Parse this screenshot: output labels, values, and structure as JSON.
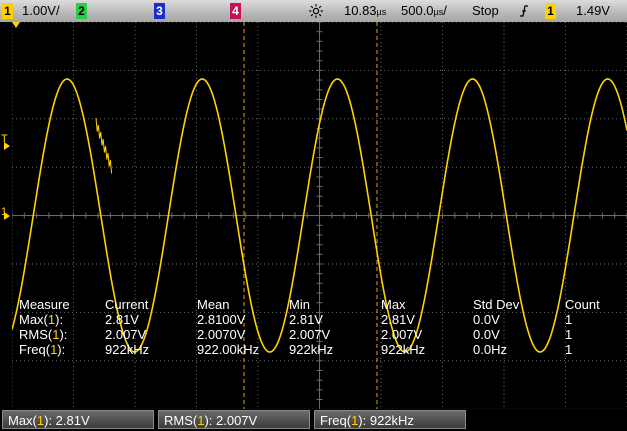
{
  "topbar": {
    "ch1_num": "1",
    "ch1_scale": "1.00V/",
    "ch2_num": "2",
    "ch3_num": "3",
    "ch4_num": "4",
    "acq_icon": "sun-icon",
    "delay": "10.83",
    "delay_unit": "µs",
    "timebase": "500.0",
    "timebase_unit": "µs",
    "timebase_suffix": "/",
    "run_state": "Stop",
    "trigger_icon": "trigger-edge-icon",
    "trig_source": "1",
    "trig_level": "1.49V"
  },
  "measure_table": {
    "headers": [
      "Measure",
      "Current",
      "Mean",
      "Min",
      "Max",
      "Std Dev",
      "Count"
    ],
    "rows": [
      {
        "label": "Max(",
        "ch": "1",
        "close": "):",
        "current": "2.81V",
        "mean": "2.8100V",
        "min": "2.81V",
        "max": "2.81V",
        "stddev": "0.0V",
        "count": "1"
      },
      {
        "label": "RMS(",
        "ch": "1",
        "close": "):",
        "current": "2.007V",
        "mean": "2.0070V",
        "min": "2.007V",
        "max": "2.007V",
        "stddev": "0.0V",
        "count": "1"
      },
      {
        "label": "Freq(",
        "ch": "1",
        "close": "):",
        "current": "922kHz",
        "mean": "922.00kHz",
        "min": "922kHz",
        "max": "922kHz",
        "stddev": "0.0Hz",
        "count": "1"
      }
    ]
  },
  "bottombar": [
    {
      "label": "Max(",
      "ch": "1",
      "value": "): 2.81V"
    },
    {
      "label": "RMS(",
      "ch": "1",
      "value": "): 2.007V"
    },
    {
      "label": "Freq(",
      "ch": "1",
      "value": "): 922kHz"
    }
  ],
  "markers": {
    "trigger_level": "T",
    "ground": "1"
  },
  "colors": {
    "ch1": "#ffd200",
    "ch2": "#2dcc46",
    "ch3": "#3b66ff",
    "ch4": "#e8417a",
    "grid": "#6a6a6a",
    "cursor": "#e8a020"
  },
  "waveform": {
    "cycles": 4.55,
    "peak": "2.81V",
    "phase_deg": 58
  }
}
